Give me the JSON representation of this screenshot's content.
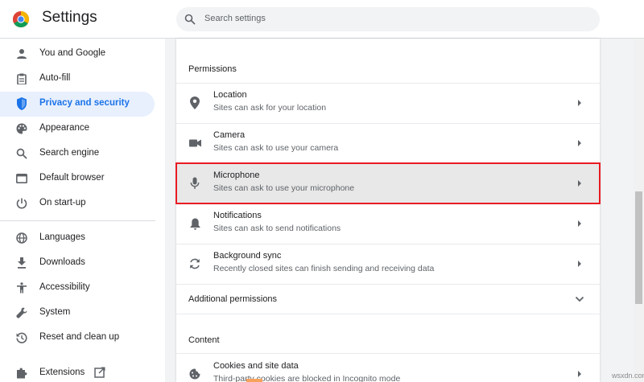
{
  "header": {
    "title": "Settings",
    "search_placeholder": "Search settings",
    "logo_icon": "chrome-logo-icon"
  },
  "sidebar": {
    "items": [
      {
        "label": "You and Google",
        "icon": "person-icon"
      },
      {
        "label": "Auto-fill",
        "icon": "clipboard-icon"
      },
      {
        "label": "Privacy and security",
        "icon": "shield-icon",
        "active": true
      },
      {
        "label": "Appearance",
        "icon": "palette-icon"
      },
      {
        "label": "Search engine",
        "icon": "search-icon"
      },
      {
        "label": "Default browser",
        "icon": "browser-icon"
      },
      {
        "label": "On start-up",
        "icon": "power-icon"
      },
      {
        "label": "Languages",
        "icon": "globe-icon"
      },
      {
        "label": "Downloads",
        "icon": "download-icon"
      },
      {
        "label": "Accessibility",
        "icon": "accessibility-icon"
      },
      {
        "label": "System",
        "icon": "wrench-icon"
      },
      {
        "label": "Reset and clean up",
        "icon": "reset-icon"
      },
      {
        "label": "Extensions",
        "icon": "puzzle-icon",
        "external": true
      }
    ]
  },
  "main": {
    "permissions_title": "Permissions",
    "permissions": [
      {
        "title": "Location",
        "subtitle": "Sites can ask for your location",
        "icon": "location-pin-icon"
      },
      {
        "title": "Camera",
        "subtitle": "Sites can ask to use your camera",
        "icon": "camera-icon"
      },
      {
        "title": "Microphone",
        "subtitle": "Sites can ask to use your microphone",
        "icon": "microphone-icon",
        "highlighted": true
      },
      {
        "title": "Notifications",
        "subtitle": "Sites can ask to send notifications",
        "icon": "bell-icon"
      },
      {
        "title": "Background sync",
        "subtitle": "Recently closed sites can finish sending and receiving data",
        "icon": "sync-icon"
      }
    ],
    "additional_permissions_label": "Additional permissions",
    "content_title": "Content",
    "content_items": [
      {
        "title": "Cookies and site data",
        "subtitle": "Third-party cookies are blocked in Incognito mode",
        "icon": "cookie-icon"
      }
    ]
  },
  "watermark": "wsxdn.com",
  "colors": {
    "accent": "#1a73e8",
    "active_bg": "#e8f0fe",
    "highlight_border": "#e81b23",
    "highlight_bg": "#e8e8e8"
  }
}
